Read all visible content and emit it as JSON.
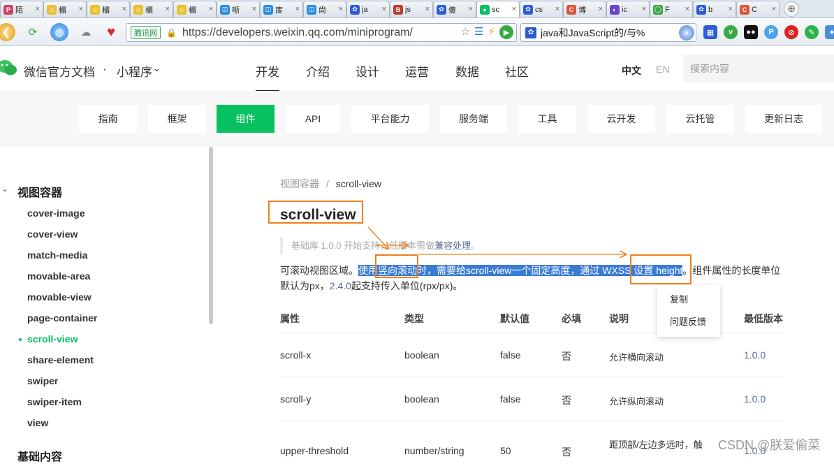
{
  "browser": {
    "tabs": [
      {
        "title": "陌",
        "fav": "#c46",
        "glyph": "P"
      },
      {
        "title": "楣",
        "fav": "#e8c030",
        "glyph": "☺"
      },
      {
        "title": "楣",
        "fav": "#e8c030",
        "glyph": "☺"
      },
      {
        "title": "楣",
        "fav": "#e8c030",
        "glyph": "☺"
      },
      {
        "title": "楣",
        "fav": "#e8c030",
        "glyph": "☺"
      },
      {
        "title": "哳",
        "fav": "#2a8de0",
        "glyph": "◫"
      },
      {
        "title": "庋",
        "fav": "#2a8de0",
        "glyph": "◫"
      },
      {
        "title": "尙",
        "fav": "#2a8de0",
        "glyph": "◫"
      },
      {
        "title": "ja",
        "fav": "#2e5cd6",
        "glyph": "✿"
      },
      {
        "title": "js",
        "fav": "#c0392b",
        "glyph": "B"
      },
      {
        "title": "傻",
        "fav": "#2e5cd6",
        "glyph": "✿"
      },
      {
        "title": "sc",
        "fav": "#07c160",
        "glyph": "●"
      },
      {
        "title": "cs",
        "fav": "#2e5cd6",
        "glyph": "✿"
      },
      {
        "title": "博",
        "fav": "#e0533d",
        "glyph": "C"
      },
      {
        "title": "ic",
        "fav": "#6b45c8",
        "glyph": "◐"
      },
      {
        "title": "F",
        "fav": "#3aa845",
        "glyph": "◯"
      },
      {
        "title": "b",
        "fav": "#2e5cd6",
        "glyph": "✿"
      },
      {
        "title": "C",
        "fav": "#e0533d",
        "glyph": "C"
      }
    ],
    "active_tab_index": 11,
    "new_tab_glyph": "⊕",
    "url_badge": "腾讯网",
    "url": "https://developers.weixin.qq.com/miniprogram/dev/component/scroll-view.html",
    "search_text": "java和JavaScript的/与%",
    "colors": {
      "accent": "#07c160",
      "link": "#576b95",
      "selection": "#3a7bd5",
      "annotation": "#f07f1b"
    }
  },
  "header": {
    "site_title": "微信官方文档",
    "separator": "·",
    "product": "小程序",
    "product_caret": "⌄",
    "nav": [
      "开发",
      "介绍",
      "设计",
      "运营",
      "数据",
      "社区"
    ],
    "active_nav": 0,
    "lang_zh": "中文",
    "lang_en": "EN",
    "search_placeholder": "搜索内容"
  },
  "categories": [
    "指南",
    "框架",
    "组件",
    "API",
    "平台能力",
    "服务端",
    "工具",
    "云开发",
    "云托管",
    "更新日志"
  ],
  "active_category": 2,
  "sidebar": {
    "group_caret": "⌄",
    "group_title": "视图容器",
    "items": [
      "cover-image",
      "cover-view",
      "match-media",
      "movable-area",
      "movable-view",
      "page-container",
      "scroll-view",
      "share-element",
      "swiper",
      "swiper-item",
      "view"
    ],
    "active_item": 6,
    "next_group": "基础内容"
  },
  "content": {
    "breadcrumb_parent": "视图容器",
    "breadcrumb_sep": "/",
    "breadcrumb_current": "scroll-view",
    "title": "scroll-view",
    "note_prefix": "基础库 1.0.0 开始支持，低版本需做",
    "note_link": "兼容处理",
    "note_suffix": "。",
    "desc_prefix": "可滚动视图区域。",
    "desc_selected": "使用竖向滚动时，需要给scroll-view一个固定高度，通过 WXSS 设置 height",
    "desc_mid": "。组件属性的长度单位默认为px，",
    "desc_version": "2.4.0",
    "desc_suffix": "起支持传入单位(rpx/px)。",
    "context_menu": [
      "复制",
      "问题反馈"
    ],
    "table": {
      "headers": [
        "属性",
        "类型",
        "默认值",
        "必填",
        "说明",
        "最低版本"
      ],
      "rows": [
        {
          "attr": "scroll-x",
          "type": "boolean",
          "default": "false",
          "required": "否",
          "desc": "允许横向滚动",
          "version": "1.0.0"
        },
        {
          "attr": "scroll-y",
          "type": "boolean",
          "default": "false",
          "required": "否",
          "desc": "允许纵向滚动",
          "version": "1.0.0"
        },
        {
          "attr": "upper-threshold",
          "type": "number/string",
          "default": "50",
          "required": "否",
          "desc": "距顶部/左边多远时，触",
          "version": "1.0.0"
        }
      ]
    }
  },
  "watermark": "CSDN @朕爱偷菜"
}
